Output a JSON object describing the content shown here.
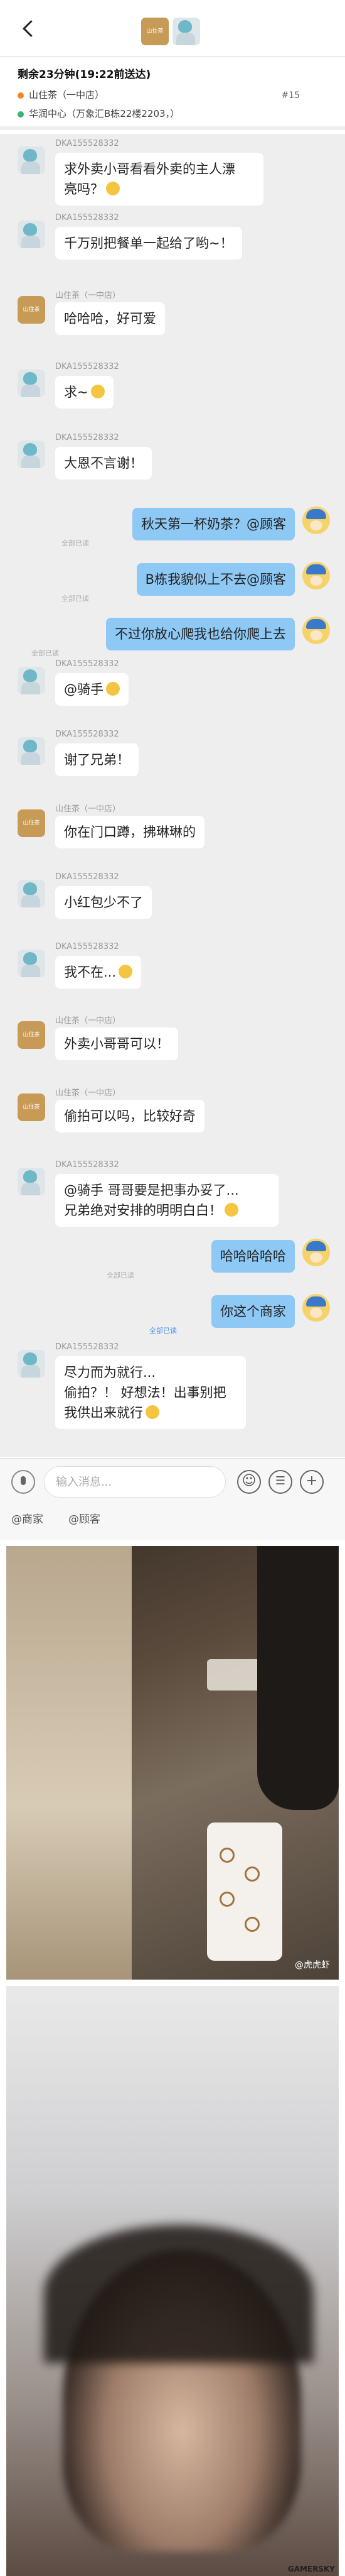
{
  "header": {
    "shop_avatar_text": "山住茶"
  },
  "order": {
    "time_left": "剩余23分钟(19:22前送达)",
    "shop": "山住茶（一中店）",
    "address": "华润中心（万象汇B栋22楼2203，）",
    "number": "#15",
    "shop_dot_color": "#f08a24",
    "address_dot_color": "#3cb371"
  },
  "messages": {
    "m1": {
      "name": "DKA155528332",
      "text": "求外卖小哥看看外卖的主人漂\n亮吗？"
    },
    "m2": {
      "name": "DKA155528332",
      "text": "千万别把餐单一起给了哟~！"
    },
    "m3": {
      "name": "山住茶（一中店）",
      "text": "哈哈哈，好可爱"
    },
    "m4": {
      "name": "DKA155528332",
      "text": "求~"
    },
    "m5": {
      "name": "DKA155528332",
      "text": "大恩不言谢！"
    },
    "m6": {
      "text": "秋天第一杯奶茶？@顾客"
    },
    "m7": {
      "text": "B栋我貌似上不去@顾客"
    },
    "m8": {
      "text": "不过你放心爬我也给你爬上去"
    },
    "m9": {
      "name": "DKA155528332",
      "text": "@骑手"
    },
    "m10": {
      "name": "DKA155528332",
      "text": "谢了兄弟！"
    },
    "m11": {
      "name": "山住茶（一中店）",
      "text": "你在门口蹲，拂琳琳的"
    },
    "m12": {
      "name": "DKA155528332",
      "text": "小红包少不了"
    },
    "m13": {
      "name": "DKA155528332",
      "text": "我不在..."
    },
    "m14": {
      "name": "山住茶（一中店）",
      "text": "外卖小哥哥可以！"
    },
    "m15": {
      "name": "山住茶（一中店）",
      "text": "偷拍可以吗，比较好奇"
    },
    "m16": {
      "name": "DKA155528332",
      "text": "@骑手 哥哥要是把事办妥了...\n兄弟绝对安排的明明白白！"
    },
    "m17": {
      "text": "哈哈哈哈哈"
    },
    "m18": {
      "text": "你这个商家"
    },
    "m19": {
      "name": "DKA155528332",
      "text": "尽力而为就行...\n偷拍？！ 好想法！出事别把\n我供出来就行"
    }
  },
  "status": {
    "all_read": "全部已读"
  },
  "input": {
    "placeholder": "输入消息...",
    "mention_shop": "@商家",
    "mention_customer": "@顾客"
  },
  "photo1": {
    "watermark": "@虎虎虾"
  },
  "photo2": {
    "watermark": "GAMERSKY"
  }
}
